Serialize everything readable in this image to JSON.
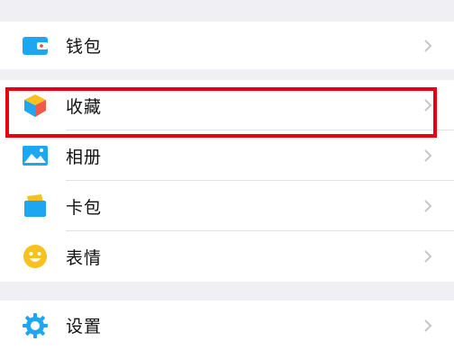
{
  "groups": [
    {
      "items": [
        {
          "id": "wallet",
          "label": "钱包",
          "icon": "wallet-icon"
        }
      ]
    },
    {
      "items": [
        {
          "id": "favorites",
          "label": "收藏",
          "icon": "cube-favorites-icon"
        },
        {
          "id": "album",
          "label": "相册",
          "icon": "photo-album-icon"
        },
        {
          "id": "card-wallet",
          "label": "卡包",
          "icon": "card-wallet-icon"
        },
        {
          "id": "stickers",
          "label": "表情",
          "icon": "smiley-icon"
        }
      ]
    },
    {
      "items": [
        {
          "id": "settings",
          "label": "设置",
          "icon": "gear-icon"
        }
      ]
    }
  ],
  "highlight": {
    "target": "favorites",
    "color": "#e60012"
  },
  "colors": {
    "accent_blue": "#1ea7f0",
    "smiley_yellow": "#f7c21e",
    "background": "#efeff4"
  }
}
